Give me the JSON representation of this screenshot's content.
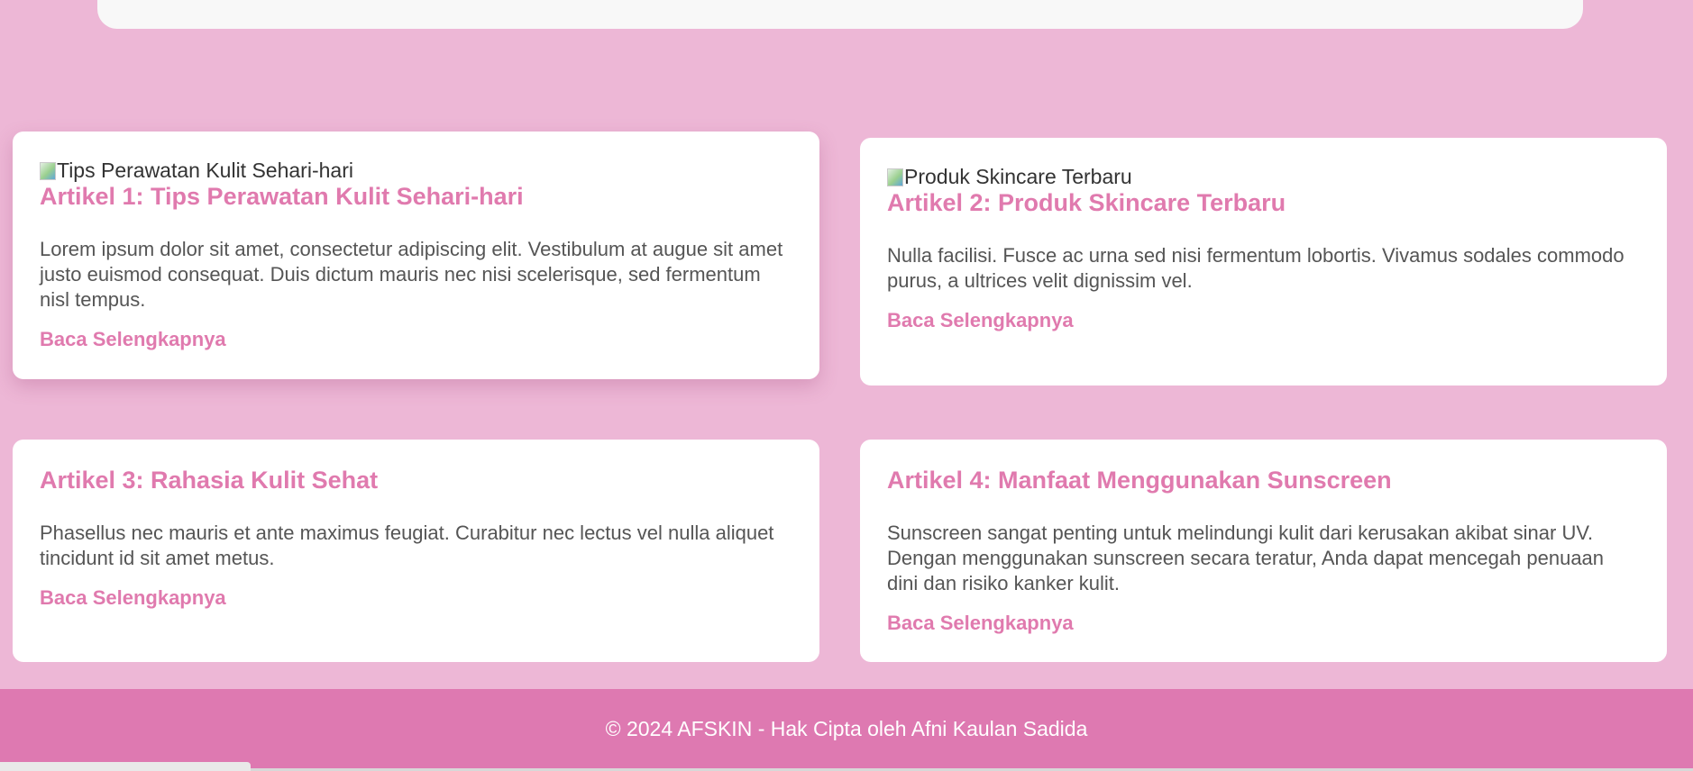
{
  "articles": [
    {
      "image_alt": "Tips Perawatan Kulit Sehari-hari",
      "title": "Artikel 1: Tips Perawatan Kulit Sehari-hari",
      "body": "Lorem ipsum dolor sit amet, consectetur adipiscing elit. Vestibulum at augue sit amet justo euismod consequat. Duis dictum mauris nec nisi scelerisque, sed fermentum nisl tempus.",
      "link": "Baca Selengkapnya"
    },
    {
      "image_alt": "Produk Skincare Terbaru",
      "title": "Artikel 2: Produk Skincare Terbaru",
      "body": "Nulla facilisi. Fusce ac urna sed nisi fermentum lobortis. Vivamus sodales commodo purus, a ultrices velit dignissim vel.",
      "link": "Baca Selengkapnya"
    },
    {
      "title": "Artikel 3: Rahasia Kulit Sehat",
      "body": "Phasellus nec mauris et ante maximus feugiat. Curabitur nec lectus vel nulla aliquet tincidunt id sit amet metus.",
      "link": "Baca Selengkapnya"
    },
    {
      "title": "Artikel 4: Manfaat Menggunakan Sunscreen",
      "body": "Sunscreen sangat penting untuk melindungi kulit dari kerusakan akibat sinar UV. Dengan menggunakan sunscreen secara teratur, Anda dapat mencegah penuaan dini dan risiko kanker kulit.",
      "link": "Baca Selengkapnya"
    }
  ],
  "footer": {
    "text": "© 2024 AFSKIN - Hak Cipta oleh Afni Kaulan Sadida"
  },
  "colors": {
    "page_background": "#edb7d6",
    "accent": "#e07aae",
    "footer_background": "#de79b1",
    "card_background": "#ffffff",
    "body_text": "#555555"
  },
  "icons": {
    "broken_image": "broken-image-icon"
  }
}
